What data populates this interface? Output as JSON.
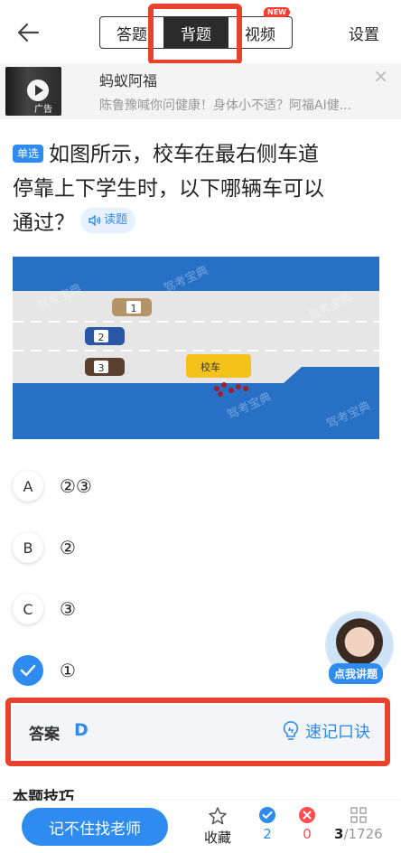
{
  "header": {
    "tabs": [
      {
        "label": "答题"
      },
      {
        "label": "背题"
      },
      {
        "label": "视频",
        "badge": "NEW"
      }
    ],
    "active_tab": "背题",
    "settings_label": "设置"
  },
  "ad": {
    "title": "蚂蚁阿福",
    "description": "陈鲁豫喊你问健康！身体小不适？阿福AI健...",
    "tag": "广告"
  },
  "question": {
    "type": "单选",
    "text_line1": "如图所示，校车在最右侧车道",
    "text_line2": "停靠上下学生时，以下哪辆车可以",
    "text_line3": "通过？",
    "read_label": "读题"
  },
  "figure": {
    "watermark": "驾考宝典",
    "school_bus_label": "校车",
    "cars": [
      "1",
      "2",
      "3"
    ]
  },
  "options": [
    {
      "letter": "A",
      "text": "②③",
      "checked": false
    },
    {
      "letter": "B",
      "text": "②",
      "checked": false
    },
    {
      "letter": "C",
      "text": "③",
      "checked": false
    },
    {
      "letter": "D",
      "text": "①",
      "checked": true
    }
  ],
  "teacher": {
    "label": "点我讲题"
  },
  "answer": {
    "label": "答案",
    "value": "D",
    "mnemonic_label": "速记口诀"
  },
  "tips_title": "本题技巧",
  "bottom": {
    "ask_button": "记不住找老师",
    "favorite_label": "收藏",
    "correct_count": "2",
    "wrong_count": "0",
    "progress_current": "3",
    "progress_total": "/1726"
  },
  "colors": {
    "accent": "#2e8bf0",
    "highlight_box": "#e8422d",
    "wrong": "#ff4d4f"
  }
}
